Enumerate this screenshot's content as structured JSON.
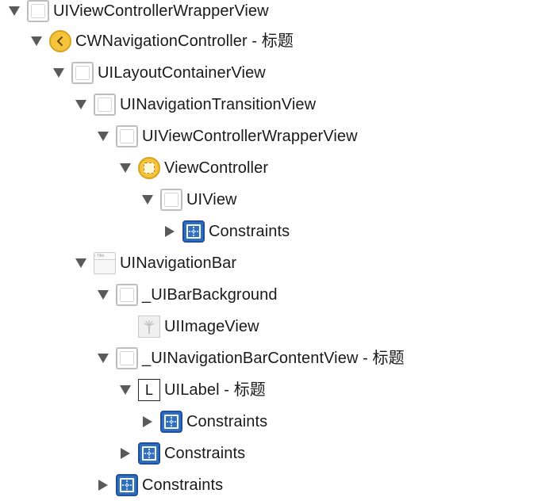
{
  "outline": {
    "items": [
      {
        "label": "UIViewControllerWrapperView",
        "icon": "view-icon",
        "expand": "down"
      },
      {
        "label": "CWNavigationController - 标题",
        "icon": "navigation-controller-icon",
        "expand": "down"
      },
      {
        "label": "UILayoutContainerView",
        "icon": "view-icon",
        "expand": "down"
      },
      {
        "label": "UINavigationTransitionView",
        "icon": "view-icon",
        "expand": "down"
      },
      {
        "label": "UIViewControllerWrapperView",
        "icon": "view-icon",
        "expand": "down"
      },
      {
        "label": "ViewController",
        "icon": "view-controller-icon",
        "expand": "down"
      },
      {
        "label": "UIView",
        "icon": "view-icon",
        "expand": "down"
      },
      {
        "label": "Constraints",
        "icon": "constraints-icon",
        "expand": "right"
      },
      {
        "label": "UINavigationBar",
        "icon": "navigation-bar-icon",
        "expand": "down",
        "icon_text": "Title"
      },
      {
        "label": "_UIBarBackground",
        "icon": "view-icon",
        "expand": "down"
      },
      {
        "label": "UIImageView",
        "icon": "image-view-icon",
        "expand": "none"
      },
      {
        "label": "_UINavigationBarContentView - 标题",
        "icon": "view-icon",
        "expand": "down"
      },
      {
        "label": "UILabel - 标题",
        "icon": "label-icon",
        "expand": "down",
        "icon_text": "L"
      },
      {
        "label": "Constraints",
        "icon": "constraints-icon",
        "expand": "right"
      },
      {
        "label": "Constraints",
        "icon": "constraints-icon",
        "expand": "right"
      },
      {
        "label": "Constraints",
        "icon": "constraints-icon",
        "expand": "right"
      }
    ]
  },
  "colors": {
    "disclosure": "#5a5a5a",
    "view_border": "#bdbdbd",
    "controller_yellow": "#f6c43a",
    "constraints_blue": "#2f6fc2"
  }
}
